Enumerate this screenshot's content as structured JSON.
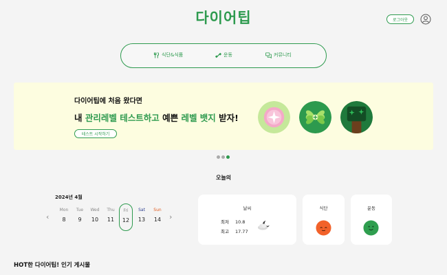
{
  "header": {
    "logo": "다이어팁",
    "logout_label": "로그아웃"
  },
  "nav": {
    "items": [
      {
        "label": "식단&식품",
        "icon": "fork-knife-icon"
      },
      {
        "label": "운동",
        "icon": "dumbbell-icon"
      },
      {
        "label": "커뮤니티",
        "icon": "chat-bubbles-icon"
      }
    ]
  },
  "banner": {
    "subtitle": "다이어팁에 처음 왔다면",
    "headline_parts": [
      "내 ",
      "관리레벨 테스트하고",
      " 예쁜 ",
      "레벨 뱃지",
      " 받자!"
    ],
    "button_label": "테스트 시작하기",
    "badges": [
      "sparkle-badge",
      "clover-badge",
      "tree-badge"
    ],
    "slides_total": 3,
    "active_slide": 3
  },
  "today": {
    "title": "오늘의",
    "calendar": {
      "month_label": "2024년  4월",
      "days": [
        {
          "name": "Mon",
          "date": "8"
        },
        {
          "name": "Tue",
          "date": "9"
        },
        {
          "name": "Wed",
          "date": "10"
        },
        {
          "name": "Thu",
          "date": "11"
        },
        {
          "name": "Fri",
          "date": "12",
          "selected": true
        },
        {
          "name": "Sat",
          "date": "13"
        },
        {
          "name": "Sun",
          "date": "14"
        }
      ]
    },
    "weather": {
      "title": "날씨",
      "min_label": "최저",
      "min_value": "10.8",
      "max_label": "최고",
      "max_value": "17.77",
      "icon": "partly-cloudy-night-icon"
    },
    "meal": {
      "title": "식단",
      "icon": "orange-face-icon"
    },
    "exercise": {
      "title": "운동",
      "icon": "green-face-icon"
    }
  },
  "popular": {
    "title": "HOT한 다이어팁! 인기 게시물"
  },
  "colors": {
    "brand": "#2d9a4e",
    "banner_bg": "#fdfde0",
    "page_bg": "#f4f4f4",
    "saturday": "#2c3e8f",
    "sunday": "#e05a1c"
  }
}
